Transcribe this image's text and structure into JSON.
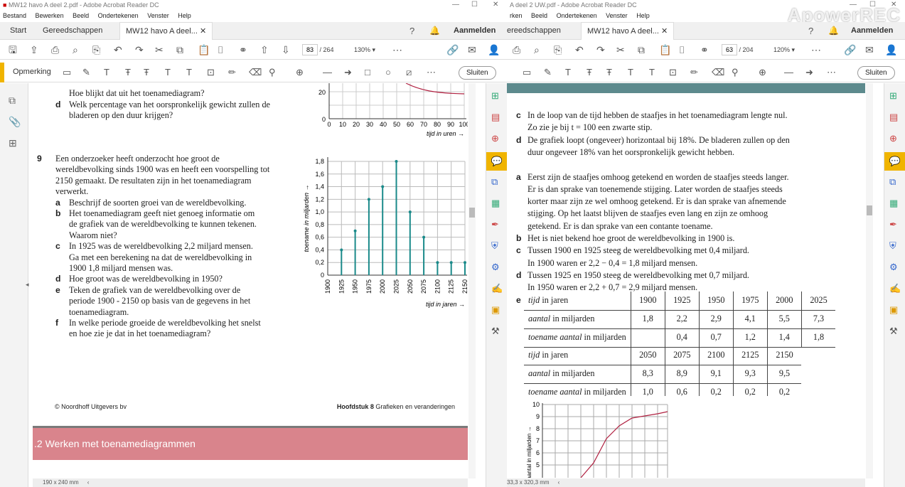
{
  "left_window": {
    "title": "MW12 havo A deel 2.pdf - Adobe Acrobat Reader DC",
    "menu": [
      "Bestand",
      "Bewerken",
      "Beeld",
      "Ondertekenen",
      "Venster",
      "Help"
    ],
    "tabs": [
      "Start",
      "Gereedschappen",
      "MW12 havo A deel..."
    ],
    "signin": "Aanmelden",
    "page_current": "83",
    "page_total": "/ 264",
    "zoom": "130%",
    "comment_label": "Opmerking",
    "close_label": "Sluiten",
    "status": "190 x 240 mm",
    "doc": {
      "top_lines": [
        "Hoe blijkt dat uit het toenamediagram?"
      ],
      "d_label": "d",
      "d_lines": [
        "Welk percentage van het oorspronkelijk gewicht zullen de",
        "bladeren op den duur krijgen?"
      ],
      "top_graph_yticks": [
        "20",
        "0"
      ],
      "top_graph_xticks": [
        "0",
        "10",
        "20",
        "30",
        "40",
        "50",
        "60",
        "70",
        "80",
        "90",
        "100"
      ],
      "top_graph_xlabel": "tijd in uren →",
      "q9_num": "9",
      "q9_lines": [
        "Een onderzoeker heeft onderzocht hoe groot de",
        "wereldbevolking sinds 1900 was en heeft een voorspelling tot",
        "2150 gemaakt. De resultaten zijn in het toenamediagram",
        "verwerkt."
      ],
      "sub": [
        {
          "l": "a",
          "lines": [
            "Beschrijf de soorten groei van de wereldbevolking."
          ]
        },
        {
          "l": "b",
          "lines": [
            "Het toenamediagram geeft niet genoeg informatie om",
            "de grafiek van de wereldbevolking te kunnen tekenen.",
            "Waarom niet?"
          ]
        },
        {
          "l": "c",
          "lines": [
            "In 1925 was de wereldbevolking 2,2 miljard mensen.",
            "Ga met een berekening na dat de wereldbevolking in",
            "1900 1,8 miljard mensen was."
          ]
        },
        {
          "l": "d",
          "lines": [
            "Hoe groot was de wereldbevolking in 1950?"
          ]
        },
        {
          "l": "e",
          "lines": [
            "Teken de grafiek van de wereldbevolking over de",
            "periode 1900 - 2150 op basis van de gegevens in het",
            "toenamediagram."
          ]
        },
        {
          "l": "f",
          "lines": [
            "In welke periode groeide de wereldbevolking het snelst",
            "en hoe zie je dat in het toenamediagram?"
          ]
        }
      ],
      "footer_left": "© Noordhoff Uitgevers bv",
      "footer_right_bold": "Hoofdstuk 8",
      "footer_right": "Grafieken en veranderingen",
      "section": ".2   Werken met toenamediagrammen"
    }
  },
  "chart_data": {
    "type": "bar",
    "categories": [
      "1900",
      "1925",
      "1950",
      "1975",
      "2000",
      "2025",
      "2050",
      "2075",
      "2100",
      "2125",
      "2150"
    ],
    "values": [
      0,
      0.4,
      0.7,
      1.2,
      1.4,
      1.8,
      1.0,
      0.6,
      0.2,
      0.2,
      0.2
    ],
    "yticks": [
      "1,8",
      "1,6",
      "1,4",
      "1,2",
      "1,0",
      "0,8",
      "0,6",
      "0,4",
      "0,2",
      "0"
    ],
    "ylabel": "toename in miljarden →",
    "xlabel": "tijd in jaren →",
    "ylim": [
      0,
      1.8
    ],
    "grid": true
  },
  "right_window": {
    "title": "A deel 2 UW.pdf - Adobe Acrobat Reader DC",
    "menu": [
      "rken",
      "Beeld",
      "Ondertekenen",
      "Venster",
      "Help"
    ],
    "tabs": [
      "ereedschappen",
      "MW12 havo A deel..."
    ],
    "signin": "Aanmelden",
    "page_current": "63",
    "page_total": "/ 204",
    "zoom": "120%",
    "close_label": "Sluiten",
    "status": "33,3 x 320,3 mm",
    "watermark": "ApowerREC",
    "doc": {
      "c_label": "c",
      "c_lines": [
        "In de loop van de tijd hebben de staafjes in het toenamediagram lengte nul.",
        "Zo zie je bij t = 100 een zwarte stip."
      ],
      "d_label": "d",
      "d_lines": [
        "De grafiek loopt (ongeveer) horizontaal bij 18%. De bladeren zullen op den",
        "duur ongeveer 18% van het oorspronkelijk gewicht hebben."
      ],
      "a_label": "a",
      "a_lines": [
        "Eerst zijn de staafjes omhoog getekend en worden de staafjes steeds langer.",
        "Er is dan sprake van toenemende stijging. Later worden de staafjes steeds",
        "korter maar zijn ze wel omhoog getekend. Er is dan sprake van afnemende",
        "stijging. Op het laatst blijven de staafjes even lang en zijn ze omhoog",
        "getekend. Er is dan sprake van een contante toename."
      ],
      "b_label": "b",
      "b_line": "Het is niet bekend hoe groot de wereldbevolking in 1900 is.",
      "c2_label": "c",
      "c2_lines": [
        "Tussen 1900 en 1925 steeg de wereldbevolking met 0,4 miljard.",
        "In 1900 waren er 2,2 − 0,4 = 1,8 miljard mensen."
      ],
      "d2_label": "d",
      "d2_lines": [
        "Tussen 1925 en 1950 steeg de wereldbevolking met 0,7 miljard.",
        "In 1950 waren er 2,2 + 0,7 = 2,9 miljard mensen."
      ],
      "e_label": "e",
      "table1": [
        [
          "tijd",
          "in jaren",
          "1900",
          "1925",
          "1950",
          "1975",
          "2000",
          "2025"
        ],
        [
          "aantal",
          "in miljarden",
          "1,8",
          "2,2",
          "2,9",
          "4,1",
          "5,5",
          "7,3"
        ],
        [
          "toename aantal",
          "in miljarden",
          "",
          "0,4",
          "0,7",
          "1,2",
          "1,4",
          "1,8"
        ]
      ],
      "table2": [
        [
          "tijd",
          "in jaren",
          "2050",
          "2075",
          "2100",
          "2125",
          "2150"
        ],
        [
          "aantal",
          "in miljarden",
          "8,3",
          "8,9",
          "9,1",
          "9,3",
          "9,5"
        ],
        [
          "toename aantal",
          "in miljarden",
          "1,0",
          "0,6",
          "0,2",
          "0,2",
          "0,2"
        ]
      ],
      "graph_yticks": [
        "10",
        "9",
        "8",
        "7",
        "6",
        "5"
      ],
      "graph_ylabel": "aantal in miljarden →"
    }
  }
}
